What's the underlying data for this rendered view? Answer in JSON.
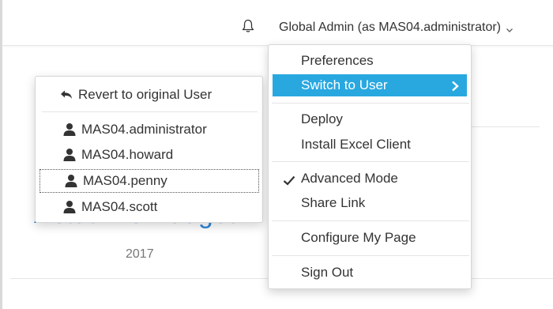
{
  "header": {
    "user_label": "Global Admin (as MAS04.administrator)"
  },
  "page": {
    "title": "Actual vs Budget",
    "year": "2017"
  },
  "user_switch": {
    "revert_label": "Revert to original User",
    "users": [
      {
        "label": "MAS04.administrator"
      },
      {
        "label": "MAS04.howard"
      },
      {
        "label": "MAS04.penny"
      },
      {
        "label": "MAS04.scott"
      }
    ],
    "focused_user": "MAS04.penny"
  },
  "account_menu": {
    "preferences": "Preferences",
    "switch_user": "Switch to User",
    "deploy": "Deploy",
    "install_excel": "Install Excel Client",
    "advanced_mode": "Advanced Mode",
    "advanced_mode_checked": true,
    "share_link": "Share Link",
    "configure_page": "Configure My Page",
    "sign_out": "Sign Out"
  },
  "colors": {
    "accent": "#29a8e0",
    "title_blue": "#2f86d6",
    "text": "#333333"
  },
  "icons": {
    "bell": "bell-icon",
    "revert": "undo-arrow-icon",
    "user": "user-icon",
    "chevron": "chevron-right-icon",
    "check": "check-icon",
    "caret": "chevron-down-icon"
  }
}
